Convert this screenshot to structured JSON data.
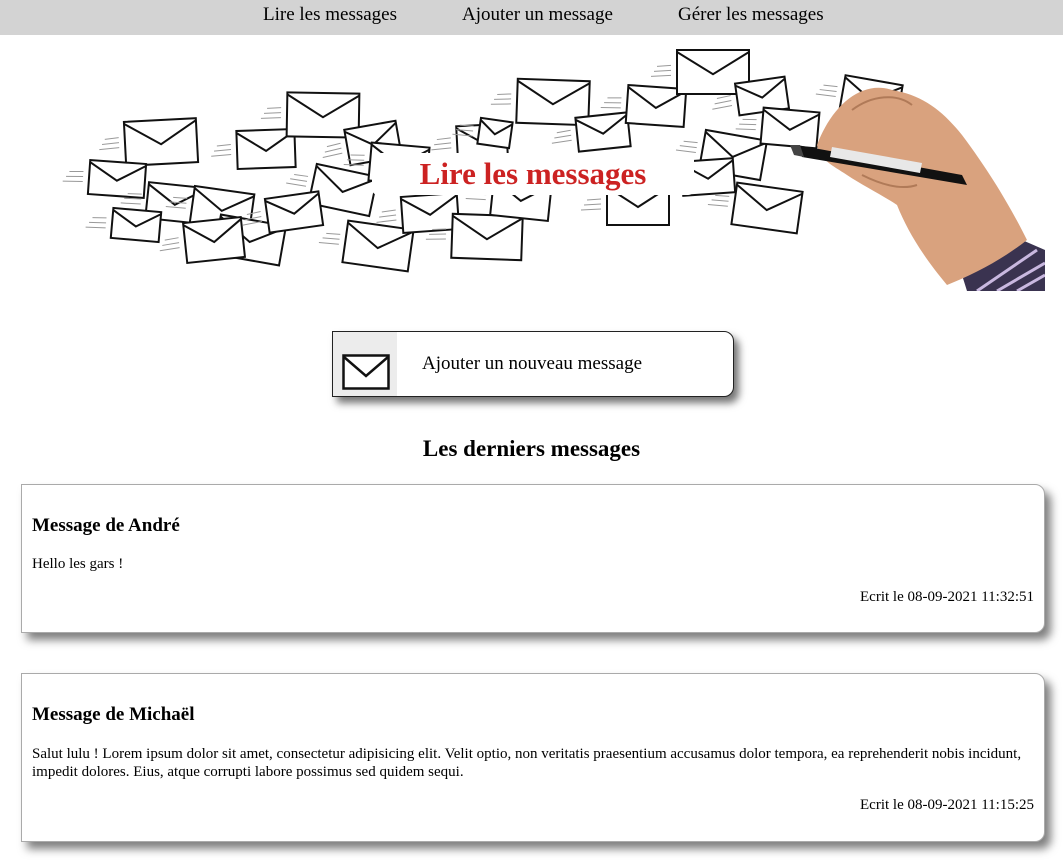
{
  "nav": {
    "items": [
      {
        "label": "Lire les messages"
      },
      {
        "label": "Ajouter un message"
      },
      {
        "label": "Gérer les messages"
      }
    ]
  },
  "banner": {
    "title": "Lire les messages",
    "title_color": "#cc2222",
    "image": "envelopes-and-hand-with-marker"
  },
  "add_button": {
    "label": "Ajouter un nouveau message",
    "icon": "envelope-icon"
  },
  "messages_section": {
    "title": "Les derniers messages"
  },
  "messages": [
    {
      "author": "Message de André",
      "body": "Hello les gars !",
      "date": "Ecrit le 08-09-2021 11:32:51"
    },
    {
      "author": "Message de Michaël",
      "body": "Salut lulu ! Lorem ipsum dolor sit amet, consectetur adipisicing elit. Velit optio, non veritatis praesentium accusamus dolor tempora, ea reprehenderit nobis incidunt, impedit dolores. Eius, atque corrupti labore possimus sed quidem sequi.",
      "date": "Ecrit le 08-09-2021 11:15:25"
    }
  ],
  "colors": {
    "nav_background": "#d3d3d3",
    "accent_red": "#cc2222"
  }
}
